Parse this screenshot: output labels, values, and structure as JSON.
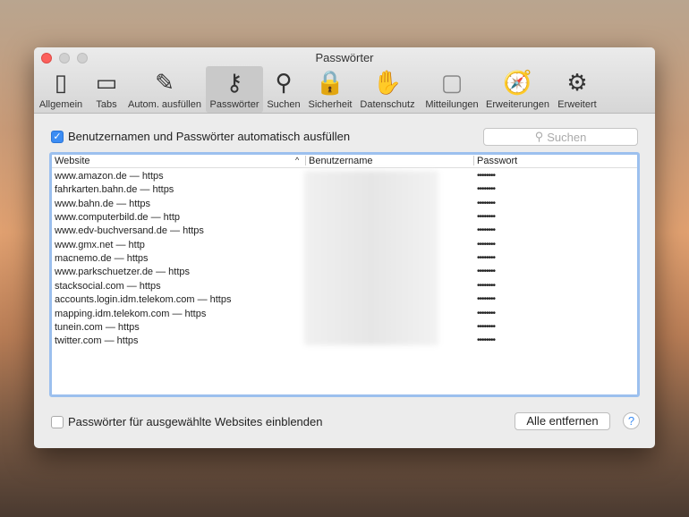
{
  "window": {
    "title": "Passwörter"
  },
  "toolbar": [
    {
      "label": "Allgemein",
      "icon": "switch-icon"
    },
    {
      "label": "Tabs",
      "icon": "tabs-icon"
    },
    {
      "label": "Autom. ausfüllen",
      "icon": "pencil-icon"
    },
    {
      "label": "Passwörter",
      "icon": "key-icon",
      "selected": true
    },
    {
      "label": "Suchen",
      "icon": "magnifier-icon"
    },
    {
      "label": "Sicherheit",
      "icon": "lock-icon"
    },
    {
      "label": "Datenschutz",
      "icon": "hand-icon"
    },
    {
      "label": "Mitteilungen",
      "icon": "notification-icon"
    },
    {
      "label": "Erweiterungen",
      "icon": "puzzle-compass-icon"
    },
    {
      "label": "Erweitert",
      "icon": "gear-icon"
    }
  ],
  "autofill": {
    "label": "Benutzernamen und Passwörter automatisch ausfüllen",
    "checked": true
  },
  "search": {
    "placeholder": "Suchen"
  },
  "table": {
    "columns": [
      "Website",
      "Benutzername",
      "Passwort"
    ],
    "rows": [
      {
        "site": "www.amazon.de — https",
        "password": "••••••••"
      },
      {
        "site": "fahrkarten.bahn.de — https",
        "password": "••••••••"
      },
      {
        "site": "www.bahn.de — https",
        "password": "••••••••"
      },
      {
        "site": "www.computerbild.de — http",
        "password": "••••••••"
      },
      {
        "site": "www.edv-buchversand.de — https",
        "password": "••••••••"
      },
      {
        "site": "www.gmx.net — http",
        "password": "••••••••"
      },
      {
        "site": "macnemo.de — https",
        "password": "••••••••"
      },
      {
        "site": "www.parkschuetzer.de — https",
        "password": "••••••••"
      },
      {
        "site": "stacksocial.com — https",
        "password": "••••••••"
      },
      {
        "site": "accounts.login.idm.telekom.com — https",
        "password": "••••••••"
      },
      {
        "site": "mapping.idm.telekom.com — https",
        "password": "••••••••"
      },
      {
        "site": "tunein.com — https",
        "password": "••••••••"
      },
      {
        "site": "twitter.com — https",
        "password": "••••••••"
      }
    ]
  },
  "show_passwords": {
    "label": "Passwörter für ausgewählte Websites einblenden",
    "checked": false
  },
  "remove_all": "Alle entfernen",
  "help": "?"
}
